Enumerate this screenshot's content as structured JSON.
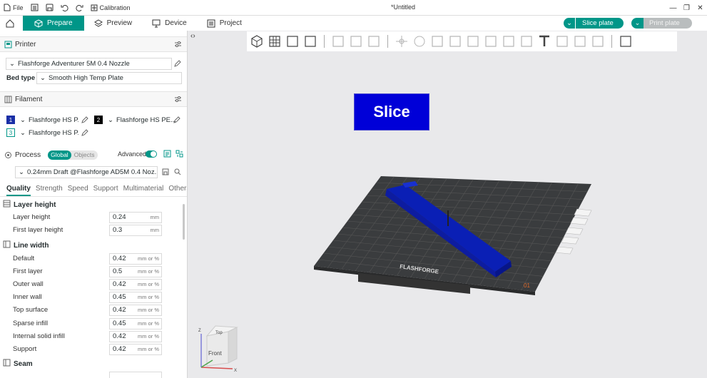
{
  "window": {
    "title": "*Untitled"
  },
  "titlebar": {
    "file": "File",
    "calibration": "Calibration"
  },
  "tabs": [
    {
      "label": "Prepare",
      "icon": "cube-icon"
    },
    {
      "label": "Preview",
      "icon": "layers-icon"
    },
    {
      "label": "Device",
      "icon": "monitor-icon"
    },
    {
      "label": "Project",
      "icon": "project-icon"
    }
  ],
  "actions": {
    "slice_plate": "Slice plate",
    "print_plate": "Print plate"
  },
  "printer": {
    "section": "Printer",
    "name": "Flashforge Adventurer 5M 0.4 Nozzle",
    "bed_type_label": "Bed type",
    "bed_type": "Smooth High Temp Plate"
  },
  "filament": {
    "section": "Filament",
    "slots": [
      {
        "num": "1",
        "name": "Flashforge HS P...",
        "color": "#1a2fa6",
        "text_color": "#ffffff"
      },
      {
        "num": "2",
        "name": "Flashforge HS PE...",
        "color": "#000000",
        "text_color": "#ffffff"
      },
      {
        "num": "3",
        "name": "Flashforge HS P...",
        "color": "#ffffff",
        "text_color": "#009688"
      }
    ]
  },
  "process": {
    "section": "Process",
    "global": "Global",
    "objects": "Objects",
    "advanced": "Advanced",
    "profile": "0.24mm Draft @Flashforge AD5M 0.4 Noz..."
  },
  "quality_tabs": [
    "Quality",
    "Strength",
    "Speed",
    "Support",
    "Multimaterial",
    "Others"
  ],
  "groups": {
    "layer_height": {
      "title": "Layer height",
      "rows": [
        {
          "label": "Layer height",
          "value": "0.24",
          "unit": "mm"
        },
        {
          "label": "First layer height",
          "value": "0.3",
          "unit": "mm"
        }
      ]
    },
    "line_width": {
      "title": "Line width",
      "rows": [
        {
          "label": "Default",
          "value": "0.42",
          "unit": "mm or %"
        },
        {
          "label": "First layer",
          "value": "0.5",
          "unit": "mm or %"
        },
        {
          "label": "Outer wall",
          "value": "0.42",
          "unit": "mm or %"
        },
        {
          "label": "Inner wall",
          "value": "0.45",
          "unit": "mm or %"
        },
        {
          "label": "Top surface",
          "value": "0.42",
          "unit": "mm or %"
        },
        {
          "label": "Sparse infill",
          "value": "0.45",
          "unit": "mm or %"
        },
        {
          "label": "Internal solid infill",
          "value": "0.42",
          "unit": "mm or %"
        },
        {
          "label": "Support",
          "value": "0.42",
          "unit": "mm or %"
        }
      ]
    },
    "seam": {
      "title": "Seam"
    }
  },
  "viewport": {
    "slice_overlay": "Slice",
    "plate_logo": "FLASHFORGE",
    "plate_number": "01",
    "axis_cube_front": "Front",
    "axis_cube_top": "Top",
    "axis_x": "X",
    "axis_z": "Z"
  },
  "colors": {
    "accent": "#009688",
    "model": "#0a1fb5",
    "slice_overlay": "#0000d8"
  }
}
